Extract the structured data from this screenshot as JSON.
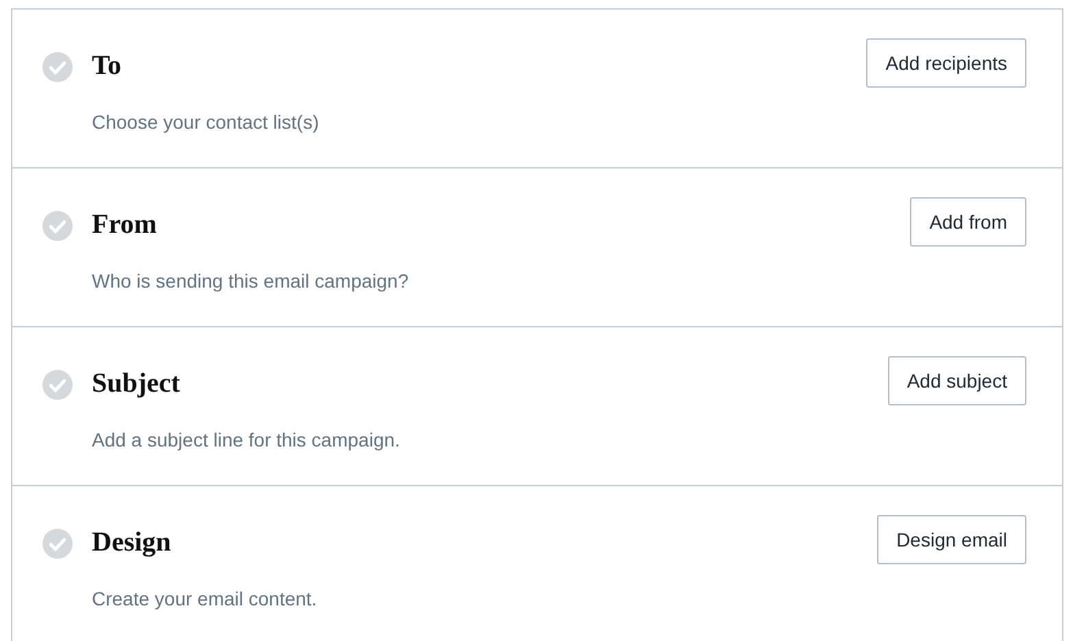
{
  "steps": [
    {
      "title": "To",
      "description": "Choose your contact list(s)",
      "button": "Add recipients",
      "done": false
    },
    {
      "title": "From",
      "description": "Who is sending this email campaign?",
      "button": "Add from",
      "done": false
    },
    {
      "title": "Subject",
      "description": "Add a subject line for this campaign.",
      "button": "Add subject",
      "done": false
    },
    {
      "title": "Design",
      "description": "Create your email content.",
      "button": "Design email",
      "done": false
    }
  ]
}
